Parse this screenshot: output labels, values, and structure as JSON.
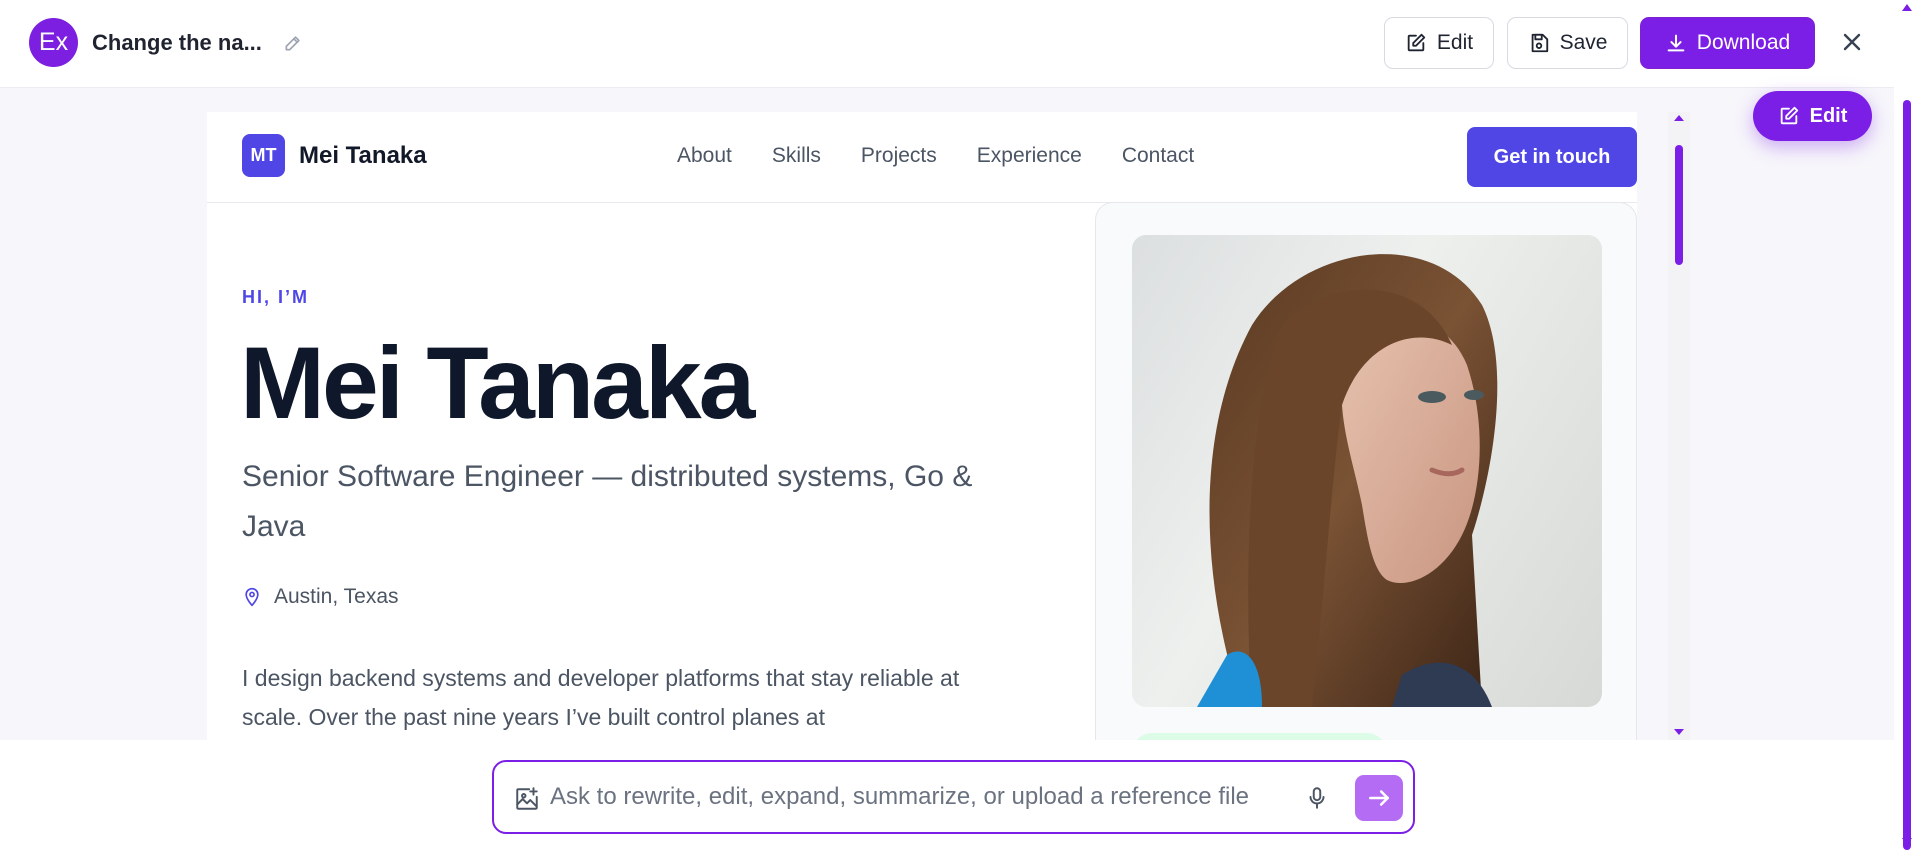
{
  "topbar": {
    "avatar_text": "Ex",
    "doc_title": "Change the na...",
    "edit_label": "Edit",
    "save_label": "Save",
    "download_label": "Download"
  },
  "floating": {
    "edit_label": "Edit"
  },
  "site": {
    "logo_initials": "MT",
    "logo_name": "Mei Tanaka",
    "nav": [
      "About",
      "Skills",
      "Projects",
      "Experience",
      "Contact"
    ],
    "cta_label": "Get in touch",
    "eyebrow": "HI, I’M",
    "hero_name": "Mei Tanaka",
    "role": "Senior Software Engineer — distributed systems, Go & Java",
    "location": "Austin, Texas",
    "bio": "I design backend systems and developer platforms that stay reliable at scale. Over the past nine years I’ve built control planes at"
  },
  "composer": {
    "placeholder": "Ask to rewrite, edit, expand, summarize, or upload a reference file"
  },
  "colors": {
    "accent": "#7c1fe6",
    "site_primary": "#4f46e5",
    "send_button": "#b46cf5"
  },
  "icons": [
    "pencil-icon",
    "edit-icon",
    "save-icon",
    "download-icon",
    "close-icon",
    "map-pin-icon",
    "image-upload-icon",
    "mic-icon",
    "arrow-right-icon"
  ]
}
